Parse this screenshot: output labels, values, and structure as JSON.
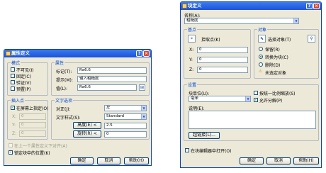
{
  "attr": {
    "title": "属性定义",
    "help_btn": "?",
    "close_btn": "×",
    "mode": {
      "label": "模式",
      "items": [
        "不可见(I)",
        "固定(C)",
        "验证(V)",
        "预置(P)"
      ]
    },
    "attribute": {
      "label": "属性",
      "tag_label": "标记(T):",
      "tag_value": "Ra6.6",
      "prompt_label": "提示(M):",
      "prompt_value": "输入粗糙度",
      "value_label": "值(L):",
      "value_value": "Ra6.6"
    },
    "insertion": {
      "label": "插入点",
      "onscreen": "在屏幕上指定(O)",
      "x": "X:",
      "y": "Y:",
      "z": "Z:",
      "x_val": "0",
      "y_val": "0",
      "z_val": "0"
    },
    "text": {
      "label": "文字选项",
      "justify_label": "对正(J):",
      "justify_value": "左",
      "style_label": "文字样式(S):",
      "style_value": "Standard",
      "height_btn": "高度(E) <",
      "height_value": "2.5",
      "rotation_btn": "旋转(R) <",
      "rotation_value": "0"
    },
    "align_below": "在上一个属性定义下对齐(A)",
    "lock_position": "锁定块中的位置(K)",
    "ok": "确定",
    "cancel": "取消",
    "help": "帮助(H)"
  },
  "block": {
    "title": "块定义",
    "help_btn": "?",
    "close_btn": "×",
    "name_label": "名称(A):",
    "name_value": "粗糙度",
    "base": {
      "label": "基点",
      "pick_btn": "拾取点(K)",
      "x": "X:",
      "y": "Y:",
      "z": "Z:",
      "x_val": "0",
      "y_val": "0",
      "z_val": "0"
    },
    "objects": {
      "label": "对象",
      "select_btn": "选择对象(T)",
      "retain": "保留(R)",
      "convert": "转换为块(C)",
      "delete": "删除(D)",
      "none_selected": "未选定对象"
    },
    "settings": {
      "label": "设置",
      "unit_label": "块单位(U):",
      "unit_value": "毫米",
      "desc_label": "说明(E):",
      "hyperlink_btn": "超链接(L)...",
      "scale_uniform": "按统一比例缩放(S)",
      "allow_explode": "允许分解(P)"
    },
    "open_in_editor": "在块编辑器中打开(O)",
    "ok": "确定",
    "cancel": "取消",
    "help": "帮助(H)"
  },
  "icons": {
    "pick": "crosshair-pick-icon",
    "select": "cursor-select-icon",
    "quick_select": "quick-select-icon",
    "warning": "warning-icon",
    "field": "insert-field-icon"
  }
}
